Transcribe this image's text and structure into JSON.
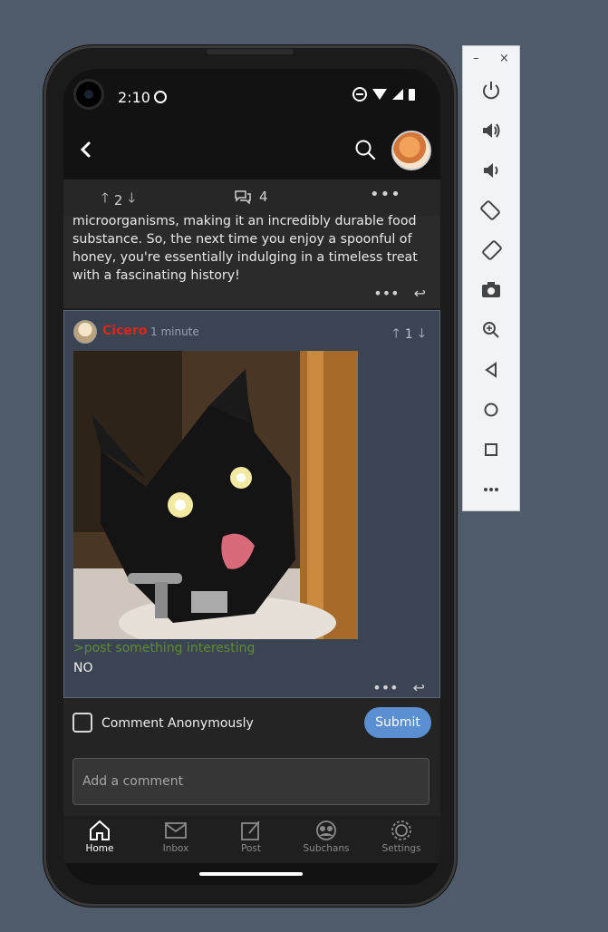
{
  "status_bar": {
    "time": "2:10"
  },
  "post_bar": {
    "score": "2",
    "comment_count": "4",
    "more": "•••"
  },
  "previous_comment": {
    "text": "microorganisms, making it an incredibly durable food substance. So, the next time you enjoy a spoonful of honey, you're essentially indulging in a timeless treat with a fascinating history!",
    "more": "•••"
  },
  "comment": {
    "author": "Cicero",
    "time": "1 minute",
    "score": "1",
    "greentext": ">post something interesting",
    "body": "NO",
    "more": "•••"
  },
  "composer": {
    "anonymous_label": "Comment Anonymously",
    "submit_label": "Submit",
    "placeholder": "Add a comment"
  },
  "tabs": [
    {
      "label": "Home",
      "icon": "home-icon"
    },
    {
      "label": "Inbox",
      "icon": "inbox-icon"
    },
    {
      "label": "Post",
      "icon": "post-icon"
    },
    {
      "label": "Subchans",
      "icon": "subchans-icon"
    },
    {
      "label": "Settings",
      "icon": "settings-icon"
    }
  ],
  "emulator": {
    "minimize": "–",
    "close": "×",
    "buttons": [
      "power-icon",
      "volume-up-icon",
      "volume-down-icon",
      "rotate-left-icon",
      "rotate-right-icon",
      "camera-icon",
      "zoom-icon",
      "back-icon",
      "home-icon",
      "overview-icon",
      "more-icon"
    ]
  },
  "colors": {
    "accent": "#5c8fd1",
    "author": "#e0251b",
    "greentext": "#5f8a35"
  }
}
